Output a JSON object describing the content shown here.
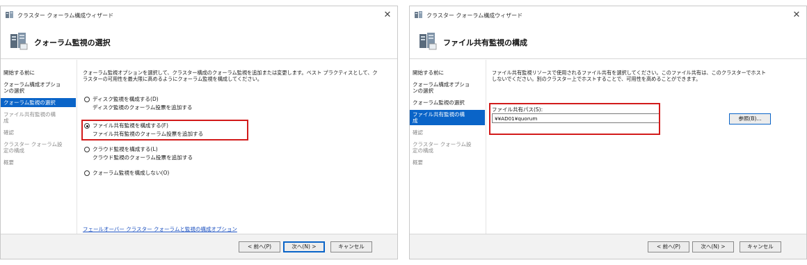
{
  "colors": {
    "accent": "#0a64c8",
    "highlight_box": "#d21a1a",
    "link": "#1a4fbf"
  },
  "window_left": {
    "title": "クラスター クォーラム構成ウィザード",
    "header_title": "クォーラム監視の選択",
    "nav": [
      {
        "label": "開始する前に",
        "state": "normal"
      },
      {
        "label": "クォーラム構成オプショ\nンの選択",
        "state": "normal"
      },
      {
        "label": "クォーラム監視の選択",
        "state": "active"
      },
      {
        "label": "ファイル共有監視の構\n成",
        "state": "disabled"
      },
      {
        "label": "確認",
        "state": "disabled"
      },
      {
        "label": "クラスター クォーラム設\n定の構成",
        "state": "disabled"
      },
      {
        "label": "概要",
        "state": "disabled"
      }
    ],
    "description": "クォーラム監視オプションを選択して、クラスター構成のクォーラム監視を追加または変更します。ベスト プラクティスとして、ク\nラスターの可用性を最大限に高めるようにクォーラム監視を構成してください。",
    "options": [
      {
        "label": "ディスク監視を構成する(D)",
        "sub": "ディスク監視のクォーラム投票を追加する",
        "checked": false
      },
      {
        "label": "ファイル共有監視を構成する(F)",
        "sub": "ファイル共有監視のクォーラム投票を追加する",
        "checked": true
      },
      {
        "label": "クラウド監視を構成する(L)",
        "sub": "クラウド監視のクォーラム投票を追加する",
        "checked": false
      },
      {
        "label": "クォーラム監視を構成しない(O)",
        "sub": "",
        "checked": false
      }
    ],
    "help_link": "フェールオーバー クラスター クォーラムと監視の構成オプション",
    "buttons": {
      "back": "< 前へ(P)",
      "next": "次へ(N) >",
      "cancel": "キャンセル"
    }
  },
  "window_right": {
    "title": "クラスター クォーラム構成ウィザード",
    "header_title": "ファイル共有監視の構成",
    "nav": [
      {
        "label": "開始する前に",
        "state": "normal"
      },
      {
        "label": "クォーラム構成オプショ\nンの選択",
        "state": "normal"
      },
      {
        "label": "クォーラム監視の選択",
        "state": "normal"
      },
      {
        "label": "ファイル共有監視の構\n成",
        "state": "active"
      },
      {
        "label": "確認",
        "state": "disabled"
      },
      {
        "label": "クラスター クォーラム設\n定の構成",
        "state": "disabled"
      },
      {
        "label": "概要",
        "state": "disabled"
      }
    ],
    "description": "ファイル共有監視リソースで使用されるファイル共有を選択してください。このファイル共有は、このクラスターでホスト\nしないでください。別のクラスター上でホストすることで、可用性を高めることができます。",
    "path_label": "ファイル共有パス(S):",
    "path_value": "¥¥AD01¥quorum",
    "browse_button": "参照(B)...",
    "buttons": {
      "back": "< 前へ(P)",
      "next": "次へ(N) >",
      "cancel": "キャンセル"
    }
  }
}
